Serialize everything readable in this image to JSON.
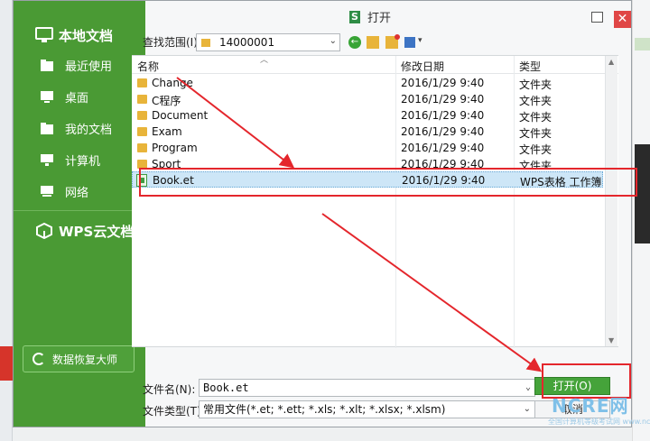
{
  "sidebar": {
    "local_title": "本地文档",
    "items": [
      {
        "label": "最近使用",
        "icon": "folder-recent-icon"
      },
      {
        "label": "桌面",
        "icon": "desktop-icon"
      },
      {
        "label": "我的文档",
        "icon": "documents-icon"
      },
      {
        "label": "计算机",
        "icon": "computer-icon"
      },
      {
        "label": "网络",
        "icon": "network-icon"
      }
    ],
    "cloud_title": "WPS云文档",
    "recover_label": "数据恢复大师"
  },
  "titlebar": {
    "logo": "S",
    "title": "打开"
  },
  "lookin": {
    "label": "查找范围(I)",
    "value": "14000001"
  },
  "columns": {
    "name": "名称",
    "date": "修改日期",
    "type": "类型"
  },
  "files": [
    {
      "name": "Change",
      "date": "2016/1/29 9:40",
      "type": "文件夹"
    },
    {
      "name": "C程序",
      "date": "2016/1/29 9:40",
      "type": "文件夹"
    },
    {
      "name": "Document",
      "date": "2016/1/29 9:40",
      "type": "文件夹"
    },
    {
      "name": "Exam",
      "date": "2016/1/29 9:40",
      "type": "文件夹"
    },
    {
      "name": "Program",
      "date": "2016/1/29 9:40",
      "type": "文件夹"
    },
    {
      "name": "Sport",
      "date": "2016/1/29 9:40",
      "type": "文件夹"
    },
    {
      "name": "Book.et",
      "date": "2016/1/29 9:40",
      "type": "WPS表格 工作簿"
    }
  ],
  "filename": {
    "label": "文件名(N):",
    "value": "Book.et"
  },
  "filetype": {
    "label": "文件类型(T)",
    "value": "常用文件(*.et; *.ett; *.xls; *.xlt; *.xlsx; *.xlsm)"
  },
  "buttons": {
    "open": "打开(O)",
    "cancel": "取消"
  },
  "watermark": {
    "brand": "NCRE网",
    "slogan": "全国计算机等级考试网 www.ncre.cn"
  },
  "colors": {
    "sidebar_green": "#4a9a34",
    "open_button": "#45a33a",
    "annotation_red": "#e4262c",
    "selection": "#cde6f7"
  }
}
